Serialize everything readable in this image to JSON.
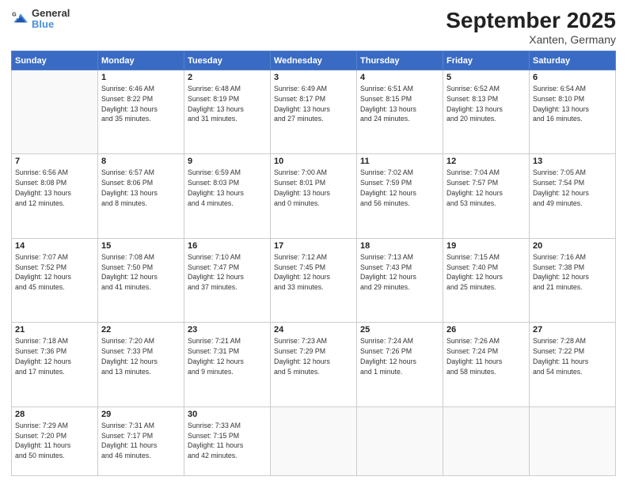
{
  "header": {
    "logo_general": "General",
    "logo_blue": "Blue",
    "title": "September 2025",
    "location": "Xanten, Germany"
  },
  "days_of_week": [
    "Sunday",
    "Monday",
    "Tuesday",
    "Wednesday",
    "Thursday",
    "Friday",
    "Saturday"
  ],
  "weeks": [
    [
      {
        "day": "",
        "info": ""
      },
      {
        "day": "1",
        "info": "Sunrise: 6:46 AM\nSunset: 8:22 PM\nDaylight: 13 hours\nand 35 minutes."
      },
      {
        "day": "2",
        "info": "Sunrise: 6:48 AM\nSunset: 8:19 PM\nDaylight: 13 hours\nand 31 minutes."
      },
      {
        "day": "3",
        "info": "Sunrise: 6:49 AM\nSunset: 8:17 PM\nDaylight: 13 hours\nand 27 minutes."
      },
      {
        "day": "4",
        "info": "Sunrise: 6:51 AM\nSunset: 8:15 PM\nDaylight: 13 hours\nand 24 minutes."
      },
      {
        "day": "5",
        "info": "Sunrise: 6:52 AM\nSunset: 8:13 PM\nDaylight: 13 hours\nand 20 minutes."
      },
      {
        "day": "6",
        "info": "Sunrise: 6:54 AM\nSunset: 8:10 PM\nDaylight: 13 hours\nand 16 minutes."
      }
    ],
    [
      {
        "day": "7",
        "info": "Sunrise: 6:56 AM\nSunset: 8:08 PM\nDaylight: 13 hours\nand 12 minutes."
      },
      {
        "day": "8",
        "info": "Sunrise: 6:57 AM\nSunset: 8:06 PM\nDaylight: 13 hours\nand 8 minutes."
      },
      {
        "day": "9",
        "info": "Sunrise: 6:59 AM\nSunset: 8:03 PM\nDaylight: 13 hours\nand 4 minutes."
      },
      {
        "day": "10",
        "info": "Sunrise: 7:00 AM\nSunset: 8:01 PM\nDaylight: 13 hours\nand 0 minutes."
      },
      {
        "day": "11",
        "info": "Sunrise: 7:02 AM\nSunset: 7:59 PM\nDaylight: 12 hours\nand 56 minutes."
      },
      {
        "day": "12",
        "info": "Sunrise: 7:04 AM\nSunset: 7:57 PM\nDaylight: 12 hours\nand 53 minutes."
      },
      {
        "day": "13",
        "info": "Sunrise: 7:05 AM\nSunset: 7:54 PM\nDaylight: 12 hours\nand 49 minutes."
      }
    ],
    [
      {
        "day": "14",
        "info": "Sunrise: 7:07 AM\nSunset: 7:52 PM\nDaylight: 12 hours\nand 45 minutes."
      },
      {
        "day": "15",
        "info": "Sunrise: 7:08 AM\nSunset: 7:50 PM\nDaylight: 12 hours\nand 41 minutes."
      },
      {
        "day": "16",
        "info": "Sunrise: 7:10 AM\nSunset: 7:47 PM\nDaylight: 12 hours\nand 37 minutes."
      },
      {
        "day": "17",
        "info": "Sunrise: 7:12 AM\nSunset: 7:45 PM\nDaylight: 12 hours\nand 33 minutes."
      },
      {
        "day": "18",
        "info": "Sunrise: 7:13 AM\nSunset: 7:43 PM\nDaylight: 12 hours\nand 29 minutes."
      },
      {
        "day": "19",
        "info": "Sunrise: 7:15 AM\nSunset: 7:40 PM\nDaylight: 12 hours\nand 25 minutes."
      },
      {
        "day": "20",
        "info": "Sunrise: 7:16 AM\nSunset: 7:38 PM\nDaylight: 12 hours\nand 21 minutes."
      }
    ],
    [
      {
        "day": "21",
        "info": "Sunrise: 7:18 AM\nSunset: 7:36 PM\nDaylight: 12 hours\nand 17 minutes."
      },
      {
        "day": "22",
        "info": "Sunrise: 7:20 AM\nSunset: 7:33 PM\nDaylight: 12 hours\nand 13 minutes."
      },
      {
        "day": "23",
        "info": "Sunrise: 7:21 AM\nSunset: 7:31 PM\nDaylight: 12 hours\nand 9 minutes."
      },
      {
        "day": "24",
        "info": "Sunrise: 7:23 AM\nSunset: 7:29 PM\nDaylight: 12 hours\nand 5 minutes."
      },
      {
        "day": "25",
        "info": "Sunrise: 7:24 AM\nSunset: 7:26 PM\nDaylight: 12 hours\nand 1 minute."
      },
      {
        "day": "26",
        "info": "Sunrise: 7:26 AM\nSunset: 7:24 PM\nDaylight: 11 hours\nand 58 minutes."
      },
      {
        "day": "27",
        "info": "Sunrise: 7:28 AM\nSunset: 7:22 PM\nDaylight: 11 hours\nand 54 minutes."
      }
    ],
    [
      {
        "day": "28",
        "info": "Sunrise: 7:29 AM\nSunset: 7:20 PM\nDaylight: 11 hours\nand 50 minutes."
      },
      {
        "day": "29",
        "info": "Sunrise: 7:31 AM\nSunset: 7:17 PM\nDaylight: 11 hours\nand 46 minutes."
      },
      {
        "day": "30",
        "info": "Sunrise: 7:33 AM\nSunset: 7:15 PM\nDaylight: 11 hours\nand 42 minutes."
      },
      {
        "day": "",
        "info": ""
      },
      {
        "day": "",
        "info": ""
      },
      {
        "day": "",
        "info": ""
      },
      {
        "day": "",
        "info": ""
      }
    ]
  ]
}
